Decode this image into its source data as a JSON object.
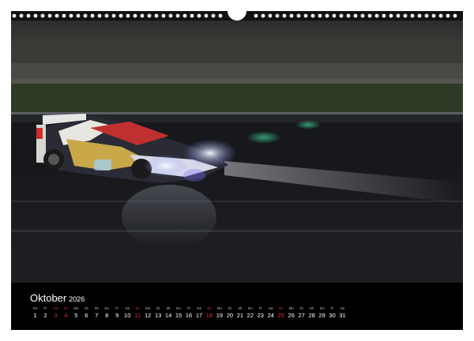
{
  "calendar": {
    "month": "Oktober",
    "year": "2026",
    "accent_color": "#e02a2a",
    "days": [
      {
        "wd": "Do",
        "num": "1",
        "red": false
      },
      {
        "wd": "Fr",
        "num": "2",
        "red": false
      },
      {
        "wd": "Sa",
        "num": "3",
        "red": true
      },
      {
        "wd": "So",
        "num": "4",
        "red": true
      },
      {
        "wd": "Mo",
        "num": "5",
        "red": false
      },
      {
        "wd": "Di",
        "num": "6",
        "red": false
      },
      {
        "wd": "Mi",
        "num": "7",
        "red": false
      },
      {
        "wd": "Do",
        "num": "8",
        "red": false
      },
      {
        "wd": "Fr",
        "num": "9",
        "red": false
      },
      {
        "wd": "Sa",
        "num": "10",
        "red": false
      },
      {
        "wd": "So",
        "num": "11",
        "red": true
      },
      {
        "wd": "Mo",
        "num": "12",
        "red": false
      },
      {
        "wd": "Di",
        "num": "13",
        "red": false
      },
      {
        "wd": "Mi",
        "num": "14",
        "red": false
      },
      {
        "wd": "Do",
        "num": "15",
        "red": false
      },
      {
        "wd": "Fr",
        "num": "16",
        "red": false
      },
      {
        "wd": "Sa",
        "num": "17",
        "red": false
      },
      {
        "wd": "So",
        "num": "18",
        "red": true
      },
      {
        "wd": "Mo",
        "num": "19",
        "red": false
      },
      {
        "wd": "Di",
        "num": "20",
        "red": false
      },
      {
        "wd": "Mi",
        "num": "21",
        "red": false
      },
      {
        "wd": "Do",
        "num": "22",
        "red": false
      },
      {
        "wd": "Fr",
        "num": "23",
        "red": false
      },
      {
        "wd": "Sa",
        "num": "24",
        "red": false
      },
      {
        "wd": "So",
        "num": "25",
        "red": true
      },
      {
        "wd": "Mo",
        "num": "26",
        "red": false
      },
      {
        "wd": "Di",
        "num": "27",
        "red": false
      },
      {
        "wd": "Mi",
        "num": "28",
        "red": false
      },
      {
        "wd": "Do",
        "num": "29",
        "red": false
      },
      {
        "wd": "Fr",
        "num": "30",
        "red": false
      },
      {
        "wd": "Sa",
        "num": "31",
        "red": false
      }
    ]
  }
}
